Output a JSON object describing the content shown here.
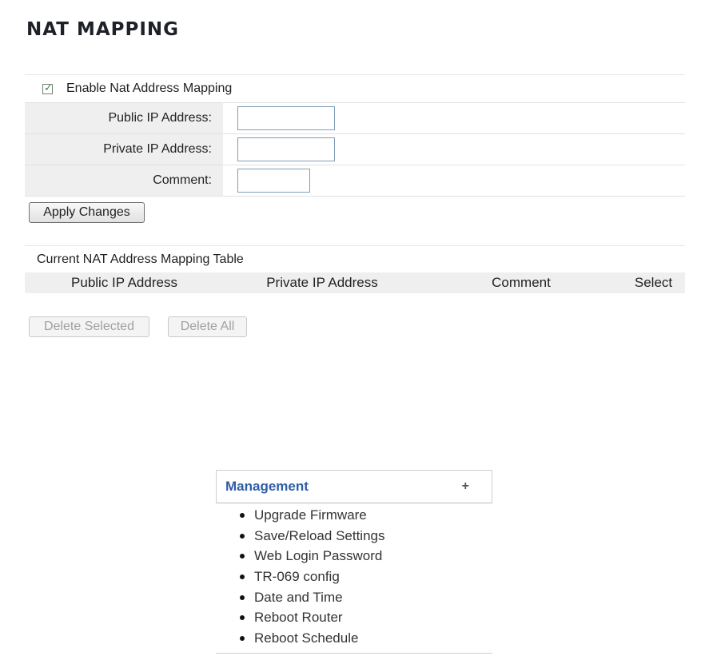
{
  "page": {
    "title": "NAT MAPPING"
  },
  "form": {
    "enable_label": "Enable Nat Address Mapping",
    "enable_checked": true,
    "public_ip_label": "Public IP Address:",
    "public_ip_value": "",
    "private_ip_label": "Private IP Address:",
    "private_ip_value": "",
    "comment_label": "Comment:",
    "comment_value": "",
    "apply_label": "Apply Changes"
  },
  "table": {
    "caption": "Current NAT Address Mapping Table",
    "columns": [
      "Public IP Address",
      "Private IP Address",
      "Comment",
      "Select"
    ],
    "rows": [],
    "delete_selected_label": "Delete Selected",
    "delete_all_label": "Delete All"
  },
  "menu": {
    "title": "Management",
    "expand_icon": "plus-icon",
    "items": [
      "Upgrade Firmware",
      "Save/Reload Settings",
      "Web Login Password",
      "TR-069 config",
      "Date and Time",
      "Reboot Router",
      "Reboot Schedule"
    ]
  },
  "colors": {
    "menu_title": "#2f5da8",
    "label_bg": "#efefef",
    "checkmark": "#2f8f2f",
    "disabled_text": "#a0a0a0"
  }
}
